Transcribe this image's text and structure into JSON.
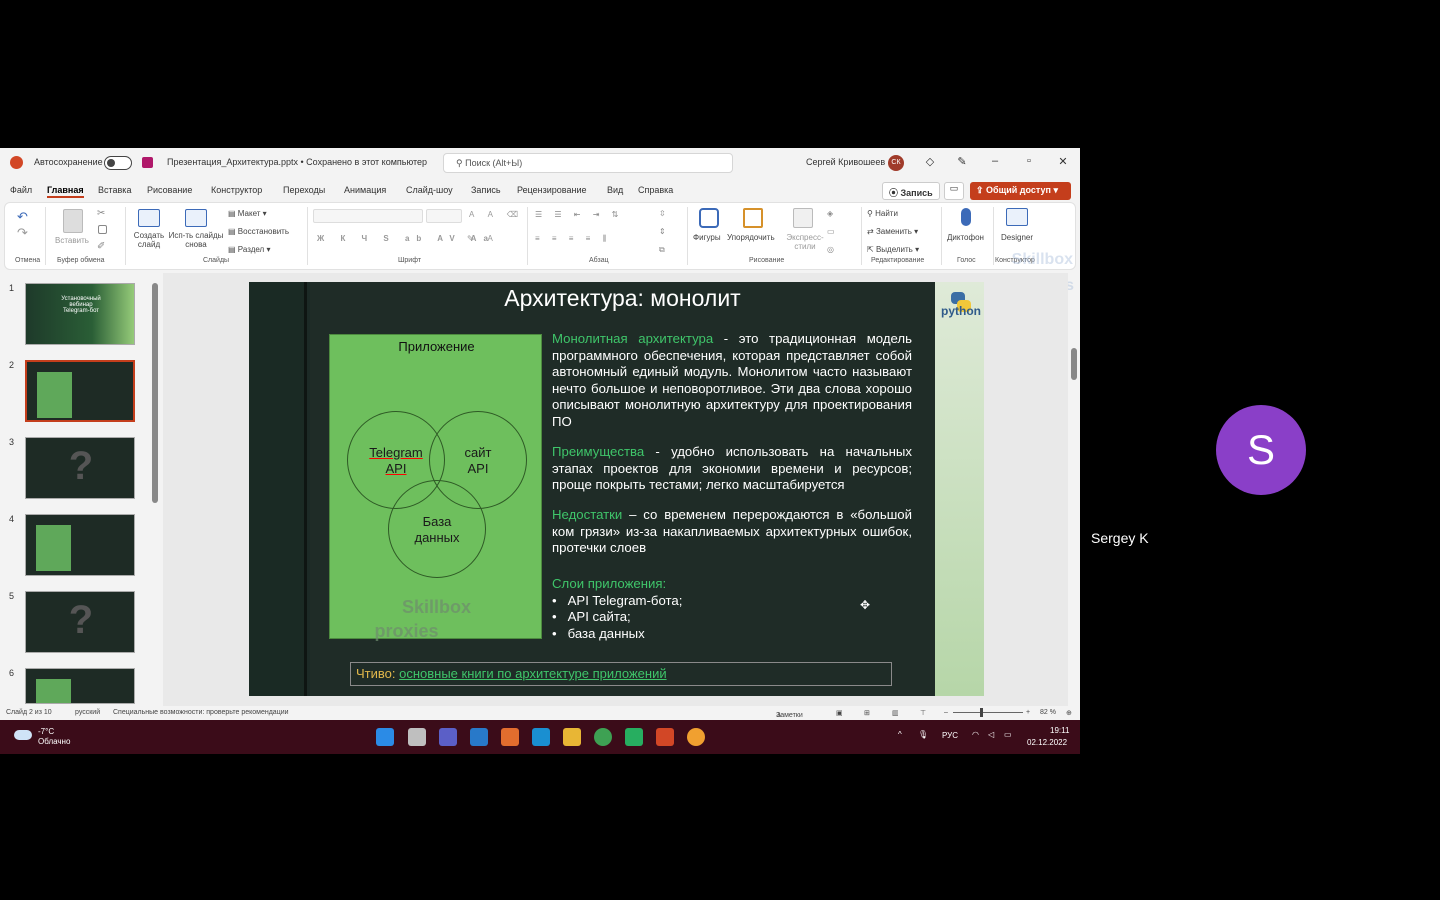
{
  "titlebar": {
    "autosave": "Автосохранение",
    "doc_title": "Презентация_Архитектура.pptx • Сохранено в этот компьютер",
    "search_placeholder": "Поиск (Alt+Ы)",
    "user_name": "Сергей Кривошеев",
    "user_initials": "СК"
  },
  "menu": {
    "tabs": [
      "Файл",
      "Главная",
      "Вставка",
      "Рисование",
      "Конструктор",
      "Переходы",
      "Анимация",
      "Слайд-шоу",
      "Запись",
      "Рецензирование",
      "Вид",
      "Справка"
    ],
    "active_tab": "Главная",
    "record": "Запись",
    "share": "Общий доступ"
  },
  "ribbon": {
    "paste": "Вставить",
    "new_slide": "Создать слайд",
    "reuse_slides": "Исп-ть слайды снова",
    "layout": "Макет",
    "reset": "Восстановить",
    "section": "Раздел",
    "shapes": "Фигуры",
    "arrange": "Упорядочить",
    "quick_styles": "Экспресс-стили",
    "find": "Найти",
    "replace": "Заменить",
    "select": "Выделить",
    "dictate": "Диктофон",
    "designer": "Designer",
    "groups": {
      "undo": "Отмена",
      "clipboard": "Буфер обмена",
      "slides": "Слайды",
      "font": "Шрифт",
      "paragraph": "Абзац",
      "drawing": "Рисование",
      "editing": "Редактирование",
      "voice": "Голос",
      "designer": "Конструктор"
    }
  },
  "thumbnails": {
    "numbers": [
      "1",
      "2",
      "3",
      "4",
      "5",
      "6"
    ],
    "slide1_text": "Установочный вебинар Telegram-бот",
    "selected": 2
  },
  "slide": {
    "title": "Архитектура: монолит",
    "app_box_caption": "Приложение",
    "circle1": "Telegram API",
    "circle2": "сайт API",
    "circle3": "База данных",
    "watermark_line1": "Skillbox",
    "watermark_line2": "proxies",
    "p1_hl": "Монолитная архитектура",
    "p1_text": " - это традиционная модель программного обеспечения, которая представляет собой автономный единый модуль. Монолитом часто называют нечто большое и неповоротливое. Эти два слова хорошо описывают монолитную архитектуру для проектирования ПО",
    "p2_hl": "Преимущества",
    "p2_text": " - удобно использовать на начальных этапах проектов для экономии времени и ресурсов; проще покрыть тестами; легко масштабируется",
    "p3_hl": "Недостатки",
    "p3_text": " – со временем перерождаются в «большой ком грязи» из-за накапливаемых архитектурных ошибок, протечки слоев",
    "layers_hl": "Слои приложения:",
    "layers": [
      "API Telegram-бота;",
      "API  сайта;",
      "база данных"
    ],
    "reading_label": "Чтиво:",
    "reading_link": "основные книги по архитектуре приложений",
    "python_label": "python",
    "corner_wm1": "Skillbox",
    "corner_wm2": "proxies"
  },
  "statusbar": {
    "slide_counter": "Слайд 2 из 10",
    "language": "русский",
    "accessibility": "Специальные возможности: проверьте рекомендации",
    "notes": "Заметки",
    "zoom": "82 %"
  },
  "taskbar": {
    "temperature": "-7°C",
    "weather": "Облачно",
    "lang": "РУС",
    "time": "19:11",
    "date": "02.12.2022"
  },
  "participant": {
    "initial": "S",
    "name": "Sergey K"
  },
  "colors": {
    "accent": "#c43e1c",
    "slide_green": "#3fc56a",
    "avatar": "#8a3fc8",
    "taskbar": "#3b0c19"
  }
}
